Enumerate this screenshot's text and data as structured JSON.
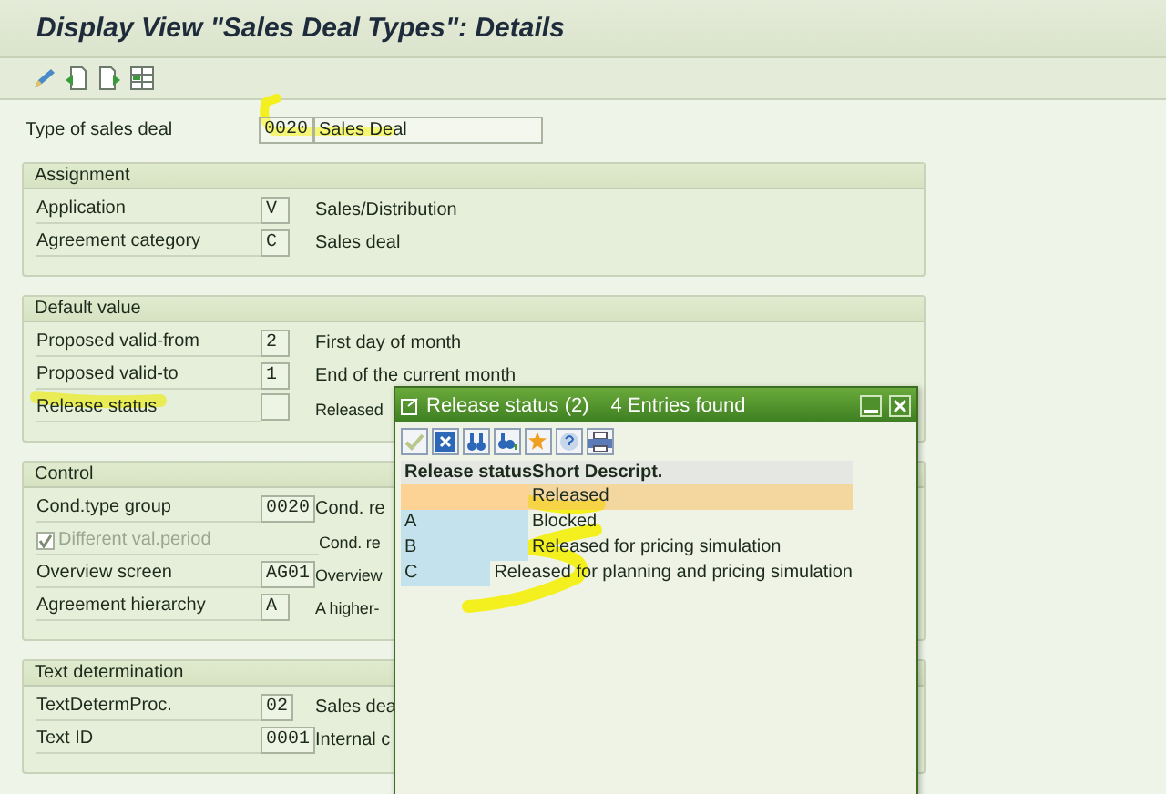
{
  "window": {
    "title": "Display View \"Sales Deal Types\": Details"
  },
  "toolbar": {
    "buttons": [
      {
        "kind": "pencil"
      },
      {
        "kind": "prev"
      },
      {
        "kind": "next"
      },
      {
        "kind": "grid"
      }
    ]
  },
  "header_field": {
    "label": "Type of sales deal",
    "key": "0020",
    "value": "Sales Deal"
  },
  "groups": [
    {
      "title": "Assignment",
      "rows": [
        {
          "kind": "field",
          "label": "Application",
          "key": "V",
          "description": "Sales/Distribution"
        },
        {
          "kind": "field",
          "label": "Agreement category",
          "key": "C",
          "description": "Sales deal"
        }
      ]
    },
    {
      "title": "Default value",
      "rows": [
        {
          "kind": "field",
          "label": "Proposed valid-from",
          "key": "2",
          "description": "First day of month"
        },
        {
          "kind": "field",
          "label": "Proposed valid-to",
          "key": "1",
          "description": "End of the current month"
        },
        {
          "kind": "field",
          "label": "Release status",
          "key": "",
          "description": "Released"
        }
      ]
    },
    {
      "title": "Control",
      "rows": [
        {
          "kind": "field",
          "label": "Cond.type group",
          "key": "0020",
          "description": "Cond. re"
        },
        {
          "kind": "checkbox",
          "label": "Different val.period",
          "checked": true,
          "disabled": true,
          "description": "Cond. re"
        },
        {
          "kind": "field",
          "label": "Overview screen",
          "key": "AG01",
          "description": "Overview"
        },
        {
          "kind": "field",
          "label": "Agreement hierarchy",
          "key": "A",
          "description": "A higher-"
        }
      ]
    },
    {
      "title": "Text determination",
      "rows": [
        {
          "kind": "field",
          "label": "TextDetermProc.",
          "key": "02",
          "description": "Sales dea"
        },
        {
          "kind": "field",
          "label": "Text ID",
          "key": "0001",
          "description": "Internal c"
        }
      ]
    }
  ],
  "popup": {
    "title": "Release status (2)",
    "status": "4 Entries found",
    "toolbar": [
      {
        "kind": "check"
      },
      {
        "kind": "cancel"
      },
      {
        "kind": "find"
      },
      {
        "kind": "find-next"
      },
      {
        "kind": "star"
      },
      {
        "kind": "help"
      },
      {
        "kind": "print"
      }
    ],
    "columns": [
      "Release status",
      "Short Descript."
    ],
    "rows": [
      {
        "key": "",
        "text": "Released",
        "selected": true
      },
      {
        "key": "A",
        "text": "Blocked",
        "selected": false
      },
      {
        "key": "B",
        "text": "Released for pricing simulation",
        "selected": false
      },
      {
        "key": "C",
        "text": "Released for planning and pricing simulation",
        "selected": false
      }
    ]
  }
}
